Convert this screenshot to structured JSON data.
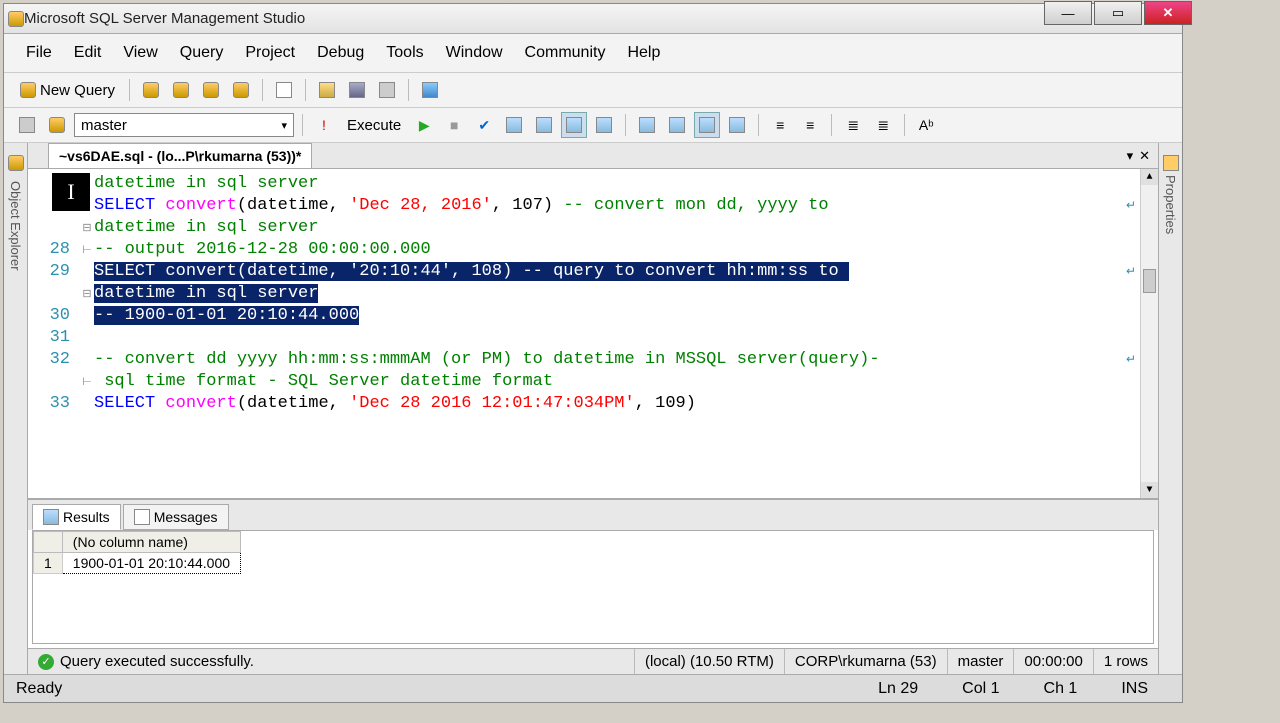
{
  "window": {
    "title": "Microsoft SQL Server Management Studio"
  },
  "menu": {
    "items": [
      "File",
      "Edit",
      "View",
      "Query",
      "Project",
      "Debug",
      "Tools",
      "Window",
      "Community",
      "Help"
    ]
  },
  "toolbar": {
    "newquery": "New Query"
  },
  "db": {
    "selected": "master",
    "execute": "Execute"
  },
  "sidebars": {
    "left": "Object Explorer",
    "right": "Properties"
  },
  "tab": {
    "title": "~vs6DAE.sql - (lo...P\\rkumarna (53))*"
  },
  "lines": {
    "blankA": "",
    "l1_text": "datetime in sql server",
    "l2_sel": "SELECT",
    "l2_conv": "convert",
    "l2_open": "(datetime, ",
    "l2_str": "'Dec 28, 2016'",
    "l2_rest": ", 107) ",
    "l2_cmt": "-- convert mon dd, yyyy to",
    "l3_cmt": "datetime in sql server",
    "n28": "28",
    "l28": "-- output 2016-12-28 00:00:00.000",
    "n29": "29",
    "l29a": "SELECT convert(datetime, '20:10:44', 108) -- query to convert hh:mm:ss to ",
    "l29b": "datetime in sql server",
    "n30": "30",
    "l30": "-- 1900-01-01 20:10:44.000",
    "n31": "31",
    "n32": "32",
    "l32a": "-- convert dd yyyy hh:mm:ss:mmmAM (or PM) to datetime in MSSQL server(query)-",
    "l32b": " sql time format - SQL Server datetime format",
    "n33": "33",
    "l33_sel": "SELECT",
    "l33_conv": "convert",
    "l33_open": "(datetime, ",
    "l33_str": "'Dec 28 2016 12:01:47:034PM'",
    "l33_rest": ", 109)"
  },
  "results": {
    "tab1": "Results",
    "tab2": "Messages",
    "col": "(No column name)",
    "row": "1",
    "val": "1900-01-01 20:10:44.000"
  },
  "status": {
    "msg": "Query executed successfully.",
    "server": "(local) (10.50 RTM)",
    "user": "CORP\\rkumarna (53)",
    "db": "master",
    "time": "00:00:00",
    "rows": "1 rows"
  },
  "appstatus": {
    "ready": "Ready",
    "ln": "Ln 29",
    "col": "Col 1",
    "ch": "Ch 1",
    "ins": "INS"
  }
}
